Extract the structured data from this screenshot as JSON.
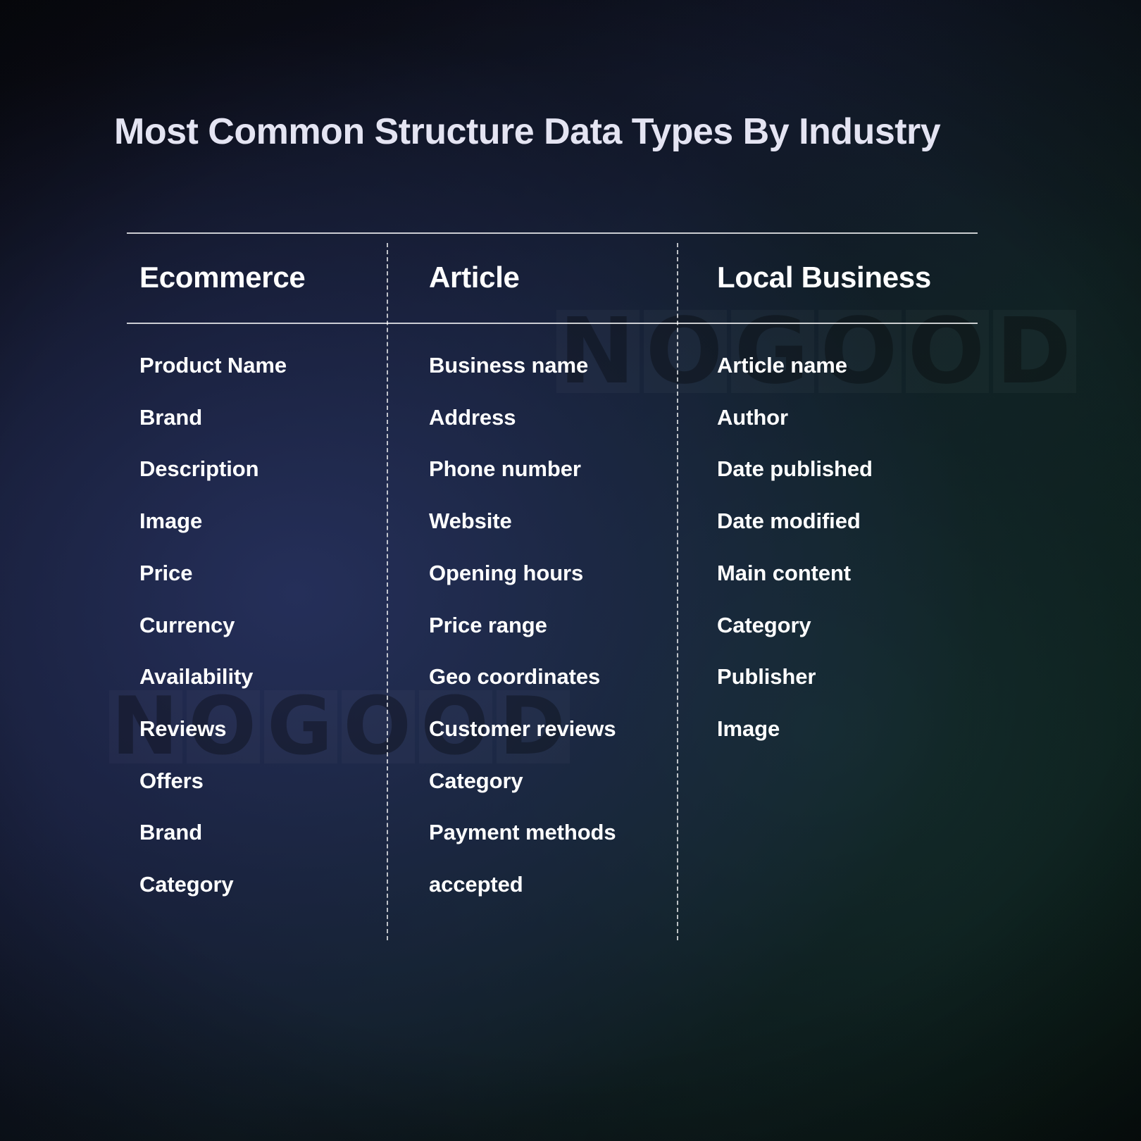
{
  "title": "Most Common Structure Data Types By Industry",
  "watermark": {
    "text": "NOGOOD",
    "letters": [
      "N",
      "O",
      "G",
      "O",
      "O",
      "D"
    ]
  },
  "theme": {
    "background_dark": "#08080b",
    "accent_navy": "#1c2444",
    "accent_green": "#13261f",
    "title_color": "#e4e4f2",
    "text_color": "#ffffff",
    "rule_color": "#ffffff"
  },
  "table": {
    "columns": [
      {
        "header": "Ecommerce",
        "items": [
          "Product Name",
          "Brand",
          "Description",
          "Image",
          "Price",
          "Currency",
          "Availability",
          "Reviews",
          "Offers",
          "Brand",
          "Category"
        ]
      },
      {
        "header": "Article",
        "items": [
          "Business name",
          "Address",
          "Phone number",
          "Website",
          "Opening hours",
          "Price range",
          "Geo coordinates",
          "Customer reviews",
          "Category",
          "Payment methods",
          "accepted"
        ]
      },
      {
        "header": "Local Business",
        "items": [
          "Article name",
          "Author",
          "Date published",
          "Date modified",
          "Main content",
          "Category",
          "Publisher",
          "Image"
        ]
      }
    ]
  }
}
